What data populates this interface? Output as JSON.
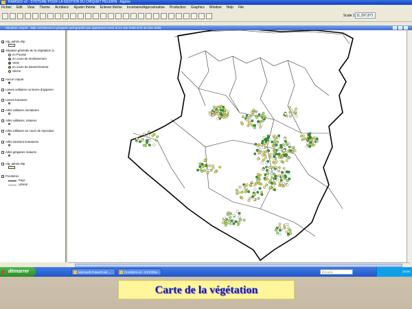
{
  "window": {
    "title": "RAMSES v3 - SYSTÈME POUR LA GESTION DU CRIQUET PÈLERIN - Algérie"
  },
  "menu": [
    "Fichier",
    "Edit",
    "View",
    "Theme",
    "Acridienc",
    "Ajouter thème",
    "Enlever thème",
    "Incertaine/Approximative",
    "Production",
    "Graphics",
    "Window",
    "Help",
    "File"
  ],
  "toolbar": {
    "scale_label": "Scale 1:",
    "scale_value": "11,297,871"
  },
  "document": {
    "title": "Situation criquet : da|lu Schistocerca gregaria cartographié par apparence entre le 01-Jan-2006  et le  31-Dec-2006"
  },
  "legend": {
    "layers": [
      {
        "label": "Alg_admin.shp",
        "checked": true
      },
      {
        "label": "Situation générale de la végétation (s",
        "checked": true
      },
      {
        "label": "Aucun criquet",
        "checked": false
      },
      {
        "label": "Larves solitaires ou larves d'apparen",
        "checked": false
      },
      {
        "label": "Larves transiens",
        "checked": false
      },
      {
        "label": "Ailés solitaires immatures",
        "checked": false
      },
      {
        "label": "Ailés solitaires, matures",
        "checked": false
      },
      {
        "label": "Ailés solitaires en cours de reproduct",
        "checked": false
      },
      {
        "label": "Ailés transient immatures",
        "checked": false
      },
      {
        "label": "Ailés grégaires matures",
        "checked": false
      },
      {
        "label": "Alg_admin.shp",
        "checked": false
      },
      {
        "label": "Frontières",
        "checked": true
      }
    ],
    "vegetation_classes": [
      {
        "label": "en Pousse",
        "color": "#ffffff"
      },
      {
        "label": "en cours de Verdissement",
        "color": "#a8e070"
      },
      {
        "label": "Verte",
        "color": "#2aa02a"
      },
      {
        "label": "en cours de Dessèchement",
        "color": "#d8d840"
      },
      {
        "label": "Sèche",
        "color": "#f0e08a"
      }
    ],
    "frontier_classes": [
      {
        "label": "Pays",
        "color": "#000000"
      },
      {
        "label": "Littoral",
        "color": "#888888"
      }
    ]
  },
  "taskbar": {
    "start_label": "démarrer",
    "tasks": [
      "Microsoft PowerPoint ...",
      "RAMSES v3 - SYSTÈM..."
    ],
    "search_placeholder": "Encarta",
    "clock": "16:09"
  },
  "caption": "Carte de la végétation",
  "colors": {
    "veg_green": "#2aa02a",
    "veg_light": "#a8e070",
    "veg_yellow": "#d8d840",
    "veg_pale": "#f0e08a",
    "veg_white": "#ffffff",
    "caption_bg": "#fff59a",
    "caption_text": "#1a1aa0"
  }
}
